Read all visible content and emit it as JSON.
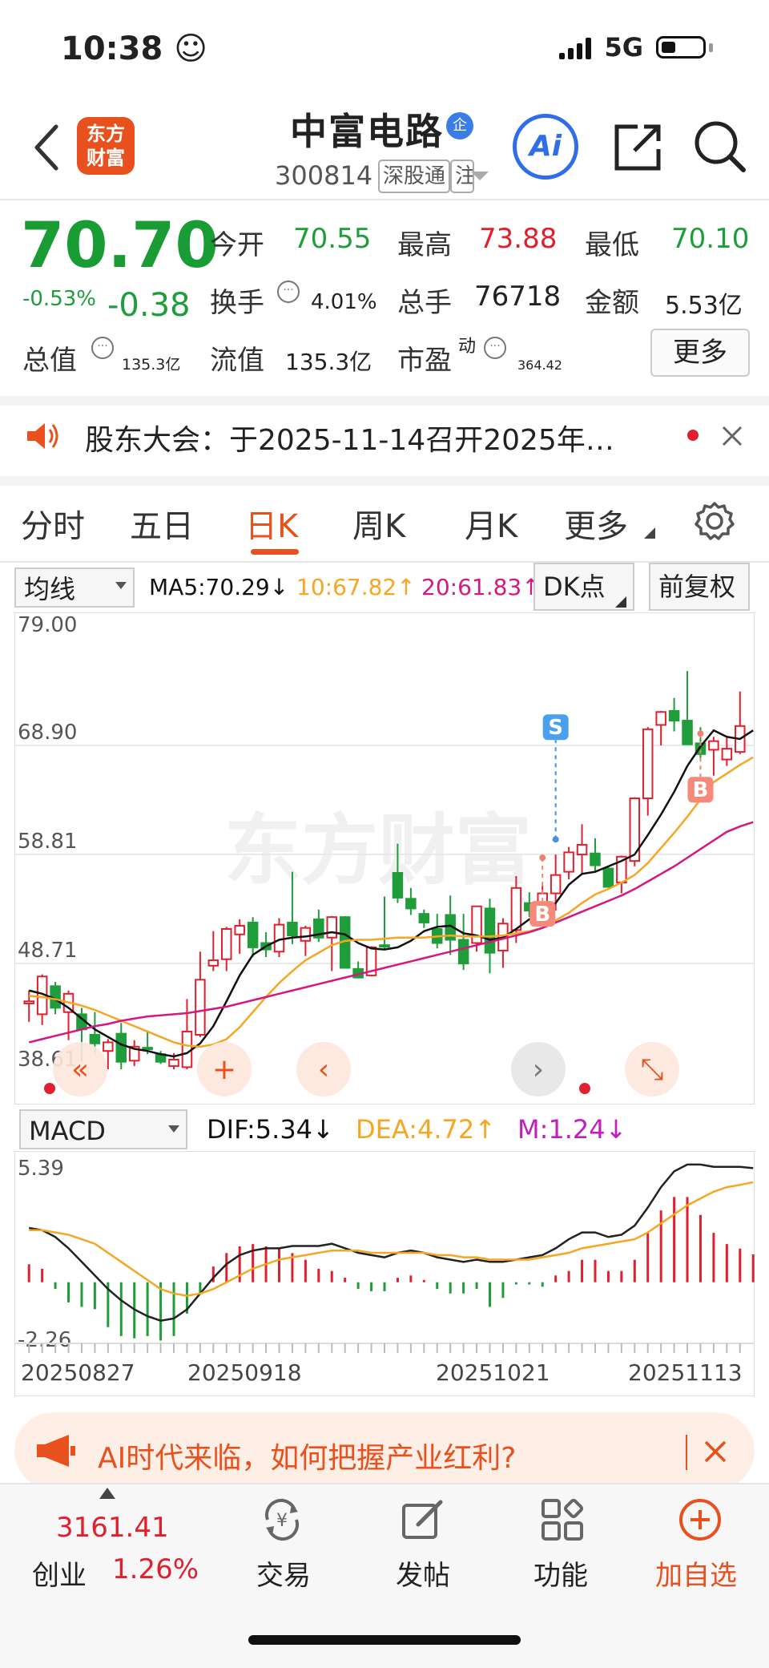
{
  "status_bar": {
    "time": "10:38 ☺",
    "network": "5G"
  },
  "header": {
    "stock_name": "中富电路",
    "name_badge": "企",
    "stock_code": "300814",
    "tags": [
      "深股通",
      "注"
    ],
    "ai_label": "Ai",
    "logo_line1": "东方",
    "logo_line2": "财富"
  },
  "quote": {
    "price": "70.70",
    "change_pct": "-0.53%",
    "change_amt": "-0.38",
    "fields": {
      "open_label": "今开",
      "open_value": "70.55",
      "high_label": "最高",
      "high_value": "73.88",
      "low_label": "最低",
      "low_value": "70.10",
      "turnover_label": "换手",
      "turnover_value": "4.01%",
      "volume_label": "总手",
      "volume_value": "76718",
      "amount_label": "金额",
      "amount_value": "5.53亿",
      "mktcap_label": "总值",
      "mktcap_value": "135.3亿",
      "float_label": "流值",
      "float_value": "135.3亿",
      "pe_label": "市盈",
      "pe_sup": "动",
      "pe_value": "364.42"
    },
    "more_button": "更多"
  },
  "notice": {
    "text": "股东大会：于2025-11-14召开2025年…"
  },
  "tabs": [
    "分时",
    "五日",
    "日K",
    "周K",
    "月K",
    "更多"
  ],
  "chart_header": {
    "indicator_select": "均线",
    "ma5": "MA5:70.29↓",
    "ma10": "10:67.82↑",
    "ma20": "20:61.83↑",
    "dk_button": "DK点",
    "adjust_button": "前复权"
  },
  "macd_header": {
    "select": "MACD",
    "dif": "DIF:5.34↓",
    "dea": "DEA:4.72↑",
    "m": "M:1.24↓"
  },
  "watermark": "东方财富",
  "colors": {
    "up": "#e0202e",
    "down": "#1f9d3a",
    "accent": "#e8511e",
    "ma5": "#111111",
    "ma10": "#f5a623",
    "ma20": "#d4187f"
  },
  "chart_data": [
    {
      "type": "candlestick",
      "title": "",
      "y_ticks": [
        "79.00",
        "68.90",
        "58.81",
        "48.71",
        "38.61"
      ],
      "ylim": [
        38.61,
        79.0
      ],
      "markers": [
        {
          "label": "S",
          "candle_index": 40,
          "price": 60.2
        },
        {
          "label": "B",
          "candle_index": 39,
          "price": 58.5
        },
        {
          "label": "B",
          "candle_index": 51,
          "price": 70.0
        }
      ],
      "candles": [
        {
          "o": 45.0,
          "h": 46.2,
          "l": 43.3,
          "c": 45.2
        },
        {
          "o": 44.0,
          "h": 47.7,
          "l": 43.0,
          "c": 47.5
        },
        {
          "o": 46.6,
          "h": 47.0,
          "l": 44.0,
          "c": 44.6
        },
        {
          "o": 44.2,
          "h": 46.2,
          "l": 41.6,
          "c": 45.9
        },
        {
          "o": 44.0,
          "h": 44.6,
          "l": 39.6,
          "c": 42.6
        },
        {
          "o": 42.1,
          "h": 44.2,
          "l": 40.3,
          "c": 41.3
        },
        {
          "o": 40.6,
          "h": 41.7,
          "l": 38.9,
          "c": 41.4
        },
        {
          "o": 42.2,
          "h": 43.2,
          "l": 38.9,
          "c": 39.6
        },
        {
          "o": 39.7,
          "h": 41.6,
          "l": 39.2,
          "c": 41.0
        },
        {
          "o": 40.9,
          "h": 42.5,
          "l": 40.3,
          "c": 40.8
        },
        {
          "o": 40.3,
          "h": 40.6,
          "l": 39.4,
          "c": 39.6
        },
        {
          "o": 39.2,
          "h": 40.4,
          "l": 38.9,
          "c": 39.8
        },
        {
          "o": 39.1,
          "h": 45.4,
          "l": 38.9,
          "c": 42.4
        },
        {
          "o": 42.1,
          "h": 49.8,
          "l": 41.9,
          "c": 47.2
        },
        {
          "o": 48.5,
          "h": 51.7,
          "l": 48.0,
          "c": 49.0
        },
        {
          "o": 49.1,
          "h": 52.1,
          "l": 48.0,
          "c": 51.9
        },
        {
          "o": 51.4,
          "h": 52.8,
          "l": 49.6,
          "c": 52.2
        },
        {
          "o": 52.5,
          "h": 53.0,
          "l": 49.3,
          "c": 50.2
        },
        {
          "o": 50.6,
          "h": 51.6,
          "l": 49.3,
          "c": 50.0
        },
        {
          "o": 49.8,
          "h": 52.9,
          "l": 49.3,
          "c": 52.3
        },
        {
          "o": 52.5,
          "h": 57.2,
          "l": 50.5,
          "c": 51.3
        },
        {
          "o": 50.8,
          "h": 52.2,
          "l": 49.4,
          "c": 52.0
        },
        {
          "o": 52.8,
          "h": 53.7,
          "l": 50.7,
          "c": 51.1
        },
        {
          "o": 51.1,
          "h": 53.1,
          "l": 48.0,
          "c": 53.0
        },
        {
          "o": 53.0,
          "h": 53.1,
          "l": 48.6,
          "c": 48.3
        },
        {
          "o": 48.2,
          "h": 48.9,
          "l": 47.9,
          "c": 47.4
        },
        {
          "o": 47.6,
          "h": 50.3,
          "l": 47.5,
          "c": 50.2
        },
        {
          "o": 50.4,
          "h": 54.9,
          "l": 50.0,
          "c": 50.3
        },
        {
          "o": 57.1,
          "h": 59.8,
          "l": 54.3,
          "c": 54.8
        },
        {
          "o": 54.7,
          "h": 55.7,
          "l": 53.2,
          "c": 53.8
        },
        {
          "o": 53.3,
          "h": 53.7,
          "l": 52.0,
          "c": 52.5
        },
        {
          "o": 51.9,
          "h": 53.3,
          "l": 50.1,
          "c": 50.6
        },
        {
          "o": 53.2,
          "h": 55.0,
          "l": 49.5,
          "c": 50.9
        },
        {
          "o": 50.9,
          "h": 53.3,
          "l": 48.1,
          "c": 48.7
        },
        {
          "o": 50.6,
          "h": 54.0,
          "l": 49.8,
          "c": 54.0
        },
        {
          "o": 53.8,
          "h": 54.7,
          "l": 47.8,
          "c": 49.7
        },
        {
          "o": 49.9,
          "h": 52.9,
          "l": 48.3,
          "c": 52.4
        },
        {
          "o": 51.8,
          "h": 56.8,
          "l": 50.6,
          "c": 55.7
        },
        {
          "o": 54.3,
          "h": 55.3,
          "l": 53.0,
          "c": 53.6
        },
        {
          "o": 53.8,
          "h": 55.9,
          "l": 53.0,
          "c": 55.2
        },
        {
          "o": 55.2,
          "h": 58.8,
          "l": 53.6,
          "c": 56.9
        },
        {
          "o": 57.2,
          "h": 59.5,
          "l": 56.5,
          "c": 59.0
        },
        {
          "o": 58.8,
          "h": 61.6,
          "l": 57.0,
          "c": 59.7
        },
        {
          "o": 58.9,
          "h": 60.3,
          "l": 57.3,
          "c": 57.8
        },
        {
          "o": 57.5,
          "h": 57.7,
          "l": 55.8,
          "c": 55.8
        },
        {
          "o": 56.2,
          "h": 58.7,
          "l": 55.2,
          "c": 58.6
        },
        {
          "o": 58.2,
          "h": 64.1,
          "l": 57.7,
          "c": 64.0
        },
        {
          "o": 64.0,
          "h": 70.6,
          "l": 62.4,
          "c": 70.4
        },
        {
          "o": 70.8,
          "h": 72.1,
          "l": 68.9,
          "c": 72.0
        },
        {
          "o": 72.1,
          "h": 73.3,
          "l": 70.2,
          "c": 71.2
        },
        {
          "o": 71.2,
          "h": 75.8,
          "l": 69.8,
          "c": 69.0
        },
        {
          "o": 69.1,
          "h": 70.6,
          "l": 67.6,
          "c": 68.1
        },
        {
          "o": 68.5,
          "h": 69.7,
          "l": 66.1,
          "c": 69.3
        },
        {
          "o": 67.6,
          "h": 69.6,
          "l": 67.0,
          "c": 68.6
        },
        {
          "o": 68.3,
          "h": 73.9,
          "l": 68.1,
          "c": 70.7
        }
      ],
      "ma5": [
        46.2,
        45.9,
        45.4,
        44.6,
        43.6,
        42.6,
        41.9,
        41.2,
        40.8,
        40.6,
        40.3,
        40.1,
        40.4,
        41.3,
        42.9,
        45.2,
        47.6,
        49.5,
        50.3,
        50.9,
        51.1,
        51.2,
        51.4,
        51.6,
        51.4,
        50.6,
        50.1,
        50.0,
        50.2,
        50.8,
        51.7,
        52.1,
        52.2,
        51.5,
        51.3,
        50.9,
        51.1,
        51.9,
        52.8,
        53.2,
        54.3,
        56.0,
        57.0,
        57.2,
        57.7,
        58.2,
        58.8,
        60.6,
        62.5,
        64.6,
        67.0,
        68.8,
        70.3,
        69.7,
        69.5,
        70.3
      ],
      "ma10": [
        45.7,
        45.6,
        45.4,
        45.1,
        44.8,
        44.4,
        43.9,
        43.4,
        42.9,
        42.4,
        41.9,
        41.4,
        41.1,
        41.0,
        41.2,
        41.7,
        42.8,
        44.2,
        45.6,
        46.9,
        48.0,
        49.0,
        49.7,
        50.4,
        50.8,
        50.9,
        50.9,
        51.0,
        51.1,
        51.1,
        51.1,
        51.2,
        51.3,
        51.2,
        51.2,
        51.2,
        51.3,
        51.5,
        51.7,
        52.0,
        52.7,
        53.4,
        54.3,
        55.1,
        55.6,
        56.2,
        56.9,
        58.0,
        59.4,
        60.8,
        62.3,
        63.9,
        65.5,
        66.3,
        67.1,
        67.8
      ],
      "ma20": [
        41.4,
        41.7,
        42.0,
        42.3,
        42.6,
        42.9,
        43.1,
        43.4,
        43.6,
        43.8,
        43.9,
        44.0,
        44.1,
        44.3,
        44.5,
        44.7,
        45.0,
        45.3,
        45.6,
        45.9,
        46.2,
        46.5,
        46.8,
        47.1,
        47.4,
        47.7,
        48.0,
        48.3,
        48.6,
        48.9,
        49.2,
        49.5,
        49.8,
        50.1,
        50.4,
        50.7,
        51.0,
        51.3,
        51.6,
        52.0,
        52.5,
        53.0,
        53.5,
        54.0,
        54.5,
        55.0,
        55.6,
        56.3,
        57.0,
        57.7,
        58.5,
        59.3,
        60.1,
        60.9,
        61.4,
        61.8
      ]
    },
    {
      "type": "bar",
      "title": "MACD",
      "y_ticks": [
        "5.39",
        "-2.26"
      ],
      "ylim": [
        -2.26,
        5.39
      ],
      "x_ticks": [
        "20250827",
        "20250918",
        "20251021",
        "20251113"
      ],
      "dif": [
        2.7,
        2.6,
        2.3,
        1.8,
        1.2,
        0.6,
        0.0,
        -0.5,
        -0.9,
        -1.2,
        -1.4,
        -1.3,
        -0.9,
        -0.2,
        0.5,
        1.1,
        1.5,
        1.7,
        1.8,
        1.8,
        1.9,
        1.9,
        1.9,
        2.0,
        1.8,
        1.6,
        1.5,
        1.4,
        1.6,
        1.7,
        1.6,
        1.4,
        1.3,
        1.2,
        1.3,
        1.2,
        1.2,
        1.3,
        1.4,
        1.5,
        1.8,
        2.2,
        2.5,
        2.5,
        2.3,
        2.4,
        2.8,
        3.6,
        4.5,
        5.2,
        5.5,
        5.5,
        5.4,
        5.4,
        5.4,
        5.34
      ],
      "dea": [
        2.6,
        2.6,
        2.5,
        2.4,
        2.2,
        2.0,
        1.6,
        1.2,
        0.8,
        0.4,
        0.0,
        -0.2,
        -0.3,
        -0.2,
        0.0,
        0.3,
        0.6,
        0.9,
        1.1,
        1.3,
        1.4,
        1.5,
        1.6,
        1.7,
        1.7,
        1.7,
        1.6,
        1.6,
        1.6,
        1.6,
        1.6,
        1.5,
        1.5,
        1.4,
        1.4,
        1.3,
        1.3,
        1.3,
        1.3,
        1.4,
        1.5,
        1.6,
        1.8,
        1.9,
        2.0,
        2.1,
        2.2,
        2.5,
        2.9,
        3.3,
        3.7,
        4.0,
        4.3,
        4.5,
        4.6,
        4.72
      ],
      "m": [
        0.8,
        0.6,
        -0.3,
        -0.9,
        -1.1,
        -1.2,
        -2.0,
        -2.4,
        -2.5,
        -2.4,
        -2.6,
        -2.4,
        -1.4,
        -0.5,
        0.7,
        1.3,
        1.6,
        1.7,
        1.6,
        1.5,
        1.3,
        1.0,
        0.6,
        0.5,
        0.2,
        -0.3,
        -0.4,
        -0.4,
        0.2,
        0.3,
        0.1,
        -0.3,
        -0.5,
        -0.5,
        -0.3,
        -1.1,
        -0.7,
        -0.1,
        -0.1,
        -0.2,
        0.3,
        0.5,
        1.0,
        1.0,
        0.5,
        0.5,
        1.0,
        2.2,
        3.2,
        3.8,
        3.8,
        3.0,
        2.2,
        1.7,
        1.5,
        1.24
      ]
    }
  ],
  "action_buttons": {
    "collapse": "«",
    "zoom_in": "+",
    "prev": "‹",
    "next": "›",
    "fullscreen": "⤡"
  },
  "promo": {
    "text": "AI时代来临，如何把握产业红利?"
  },
  "bottom_bar": {
    "index_value": "3161.41",
    "index_name": "创业",
    "index_change": "1.26%",
    "items": [
      "交易",
      "发帖",
      "功能",
      "加自选"
    ]
  }
}
